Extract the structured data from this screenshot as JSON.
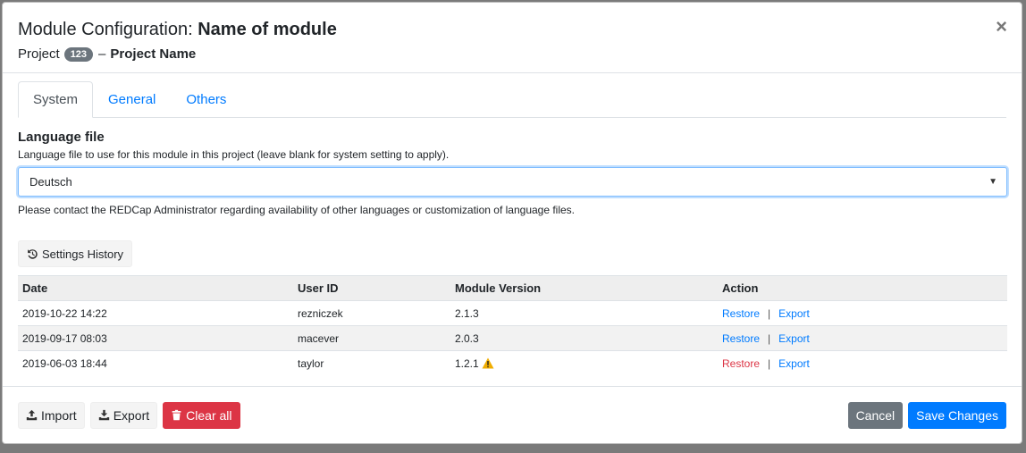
{
  "header": {
    "title_prefix": "Module Configuration: ",
    "title_module": "Name of module",
    "project_label": "Project",
    "project_id": "123",
    "dash": "–",
    "project_name": "Project Name",
    "close_glyph": "×"
  },
  "tabs": [
    {
      "label": "System"
    },
    {
      "label": "General"
    },
    {
      "label": "Others"
    }
  ],
  "language": {
    "label": "Language file",
    "description": "Language file to use for this module in this project (leave blank for system setting to apply).",
    "selected": "Deutsch",
    "help": "Please contact the REDCap Administrator regarding availability of other languages or customization of language files."
  },
  "history": {
    "button_label": "Settings History",
    "columns": [
      "Date",
      "User ID",
      "Module Version",
      "Action"
    ],
    "rows": [
      {
        "date": "2019-10-22 14:22",
        "user": "rezniczek",
        "version": "2.1.3",
        "restore": "Restore",
        "export": "Export"
      },
      {
        "date": "2019-09-17 08:03",
        "user": "macever",
        "version": "2.0.3",
        "restore": "Restore",
        "export": "Export"
      },
      {
        "date": "2019-06-03 18:44",
        "user": "taylor",
        "version": "1.2.1",
        "restore": "Restore",
        "export": "Export"
      }
    ],
    "separator": "|"
  },
  "footer": {
    "import_label": "Import",
    "export_label": "Export",
    "clear_label": "Clear all",
    "cancel_label": "Cancel",
    "save_label": "Save Changes"
  },
  "colors": {
    "primary": "#007bff",
    "danger": "#dc3545",
    "secondary": "#6c757d",
    "warning": "#f0ad00"
  }
}
